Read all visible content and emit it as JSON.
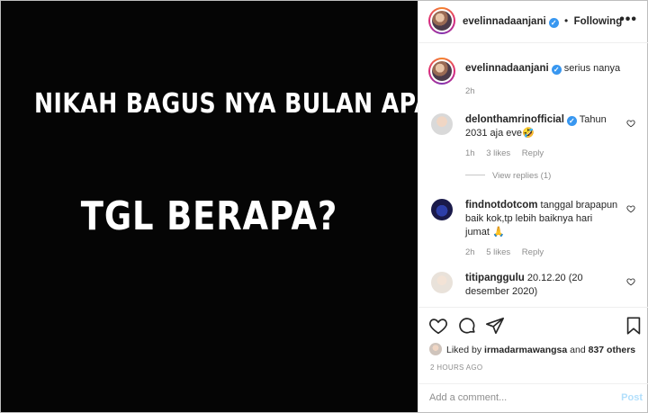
{
  "media": {
    "line1": "NIKAH BAGUS NYA BULAN APA?",
    "line2": "TGL BERAPA?"
  },
  "header": {
    "username": "evelinnadaanjani",
    "separator": "•",
    "follow_label": "Following",
    "more_icon": "more-icon"
  },
  "caption": {
    "username": "evelinnadaanjani",
    "text": "serius nanya",
    "time": "2h"
  },
  "comments": [
    {
      "username": "delonthamrinofficial",
      "verified": true,
      "text": "Tahun 2031 aja eve🤣",
      "time": "1h",
      "likes": "3 likes",
      "reply": "Reply",
      "view_replies": "View replies (1)"
    },
    {
      "username": "findnotdotcom",
      "verified": false,
      "text": "tanggal brapapun baik kok,tp lebih baiknya hari jumat 🙏",
      "time": "2h",
      "likes": "5 likes",
      "reply": "Reply"
    },
    {
      "username": "titipanggulu",
      "verified": false,
      "text": "20.12.20 (20 desember 2020)"
    }
  ],
  "likes": {
    "prefix": "Liked by",
    "user": "irmadarmawangsa",
    "conj": "and",
    "others": "837 others"
  },
  "timestamp": "2 HOURS AGO",
  "add_comment": {
    "placeholder": "Add a comment...",
    "post_label": "Post"
  },
  "colors": {
    "verified": "#3897f0",
    "post_disabled": "#b2dffc",
    "muted": "#8e8e8e"
  }
}
